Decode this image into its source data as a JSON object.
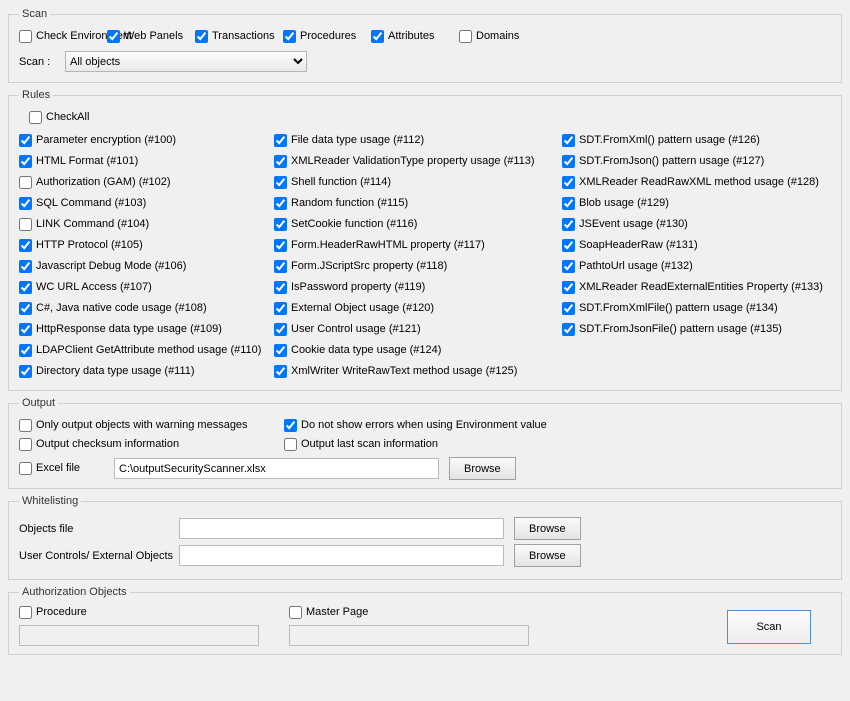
{
  "scan": {
    "legend": "Scan",
    "types": [
      {
        "label": "Check Environment",
        "checked": false
      },
      {
        "label": "Web Panels",
        "checked": true
      },
      {
        "label": "Transactions",
        "checked": true
      },
      {
        "label": "Procedures",
        "checked": true
      },
      {
        "label": "Attributes",
        "checked": true
      },
      {
        "label": "Domains",
        "checked": false
      }
    ],
    "selectLabel": "Scan :",
    "selectValue": "All objects"
  },
  "rules": {
    "legend": "Rules",
    "checkAll": {
      "label": "CheckAll",
      "checked": false
    },
    "col1": [
      {
        "label": "Parameter encryption (#100)",
        "checked": true
      },
      {
        "label": "HTML Format (#101)",
        "checked": true
      },
      {
        "label": "Authorization (GAM) (#102)",
        "checked": false
      },
      {
        "label": "SQL Command (#103)",
        "checked": true
      },
      {
        "label": "LINK Command (#104)",
        "checked": false
      },
      {
        "label": "HTTP Protocol (#105)",
        "checked": true
      },
      {
        "label": "Javascript Debug Mode (#106)",
        "checked": true
      },
      {
        "label": "WC URL Access (#107)",
        "checked": true
      },
      {
        "label": "C#, Java native code usage (#108)",
        "checked": true
      },
      {
        "label": "HttpResponse data type usage (#109)",
        "checked": true
      },
      {
        "label": "LDAPClient GetAttribute method usage (#110)",
        "checked": true
      },
      {
        "label": "Directory data type usage (#111)",
        "checked": true
      }
    ],
    "col2": [
      {
        "label": "File data type usage (#112)",
        "checked": true
      },
      {
        "label": "XMLReader ValidationType property usage (#113)",
        "checked": true
      },
      {
        "label": "Shell function (#114)",
        "checked": true
      },
      {
        "label": "Random function (#115)",
        "checked": true
      },
      {
        "label": "SetCookie function (#116)",
        "checked": true
      },
      {
        "label": "Form.HeaderRawHTML property (#117)",
        "checked": true
      },
      {
        "label": "Form.JScriptSrc property (#118)",
        "checked": true
      },
      {
        "label": "IsPassword property (#119)",
        "checked": true
      },
      {
        "label": "External Object usage (#120)",
        "checked": true
      },
      {
        "label": "User Control usage (#121)",
        "checked": true
      },
      {
        "label": "Cookie data type usage (#124)",
        "checked": true
      },
      {
        "label": "XmlWriter WriteRawText method usage (#125)",
        "checked": true
      }
    ],
    "col3": [
      {
        "label": "SDT.FromXml() pattern usage (#126)",
        "checked": true
      },
      {
        "label": "SDT.FromJson() pattern usage (#127)",
        "checked": true
      },
      {
        "label": "XMLReader ReadRawXML method usage (#128)",
        "checked": true
      },
      {
        "label": "Blob usage (#129)",
        "checked": true
      },
      {
        "label": "JSEvent usage (#130)",
        "checked": true
      },
      {
        "label": "SoapHeaderRaw (#131)",
        "checked": true
      },
      {
        "label": "PathtoUrl usage (#132)",
        "checked": true
      },
      {
        "label": "XMLReader ReadExternalEntities Property (#133)",
        "checked": true
      },
      {
        "label": "SDT.FromXmlFile() pattern usage (#134)",
        "checked": true
      },
      {
        "label": "SDT.FromJsonFile() pattern usage (#135)",
        "checked": true
      }
    ]
  },
  "output": {
    "legend": "Output",
    "row1": [
      {
        "label": "Only output objects with warning messages",
        "checked": false
      },
      {
        "label": "Do not show errors when using Environment value",
        "checked": true
      }
    ],
    "row2": [
      {
        "label": "Output checksum information",
        "checked": false
      },
      {
        "label": "Output last scan information",
        "checked": false
      }
    ],
    "excel": {
      "label": "Excel file",
      "checked": false,
      "path": "C:\\outputSecurityScanner.xlsx",
      "browse": "Browse"
    }
  },
  "whitelisting": {
    "legend": "Whitelisting",
    "objects": {
      "label": "Objects file",
      "value": "",
      "browse": "Browse"
    },
    "userControls": {
      "label": "User Controls/ External Objects",
      "value": "",
      "browse": "Browse"
    }
  },
  "auth": {
    "legend": "Authorization Objects",
    "procedure": {
      "label": "Procedure",
      "checked": false,
      "value": ""
    },
    "master": {
      "label": "Master Page",
      "checked": false,
      "value": ""
    },
    "scanBtn": "Scan"
  }
}
